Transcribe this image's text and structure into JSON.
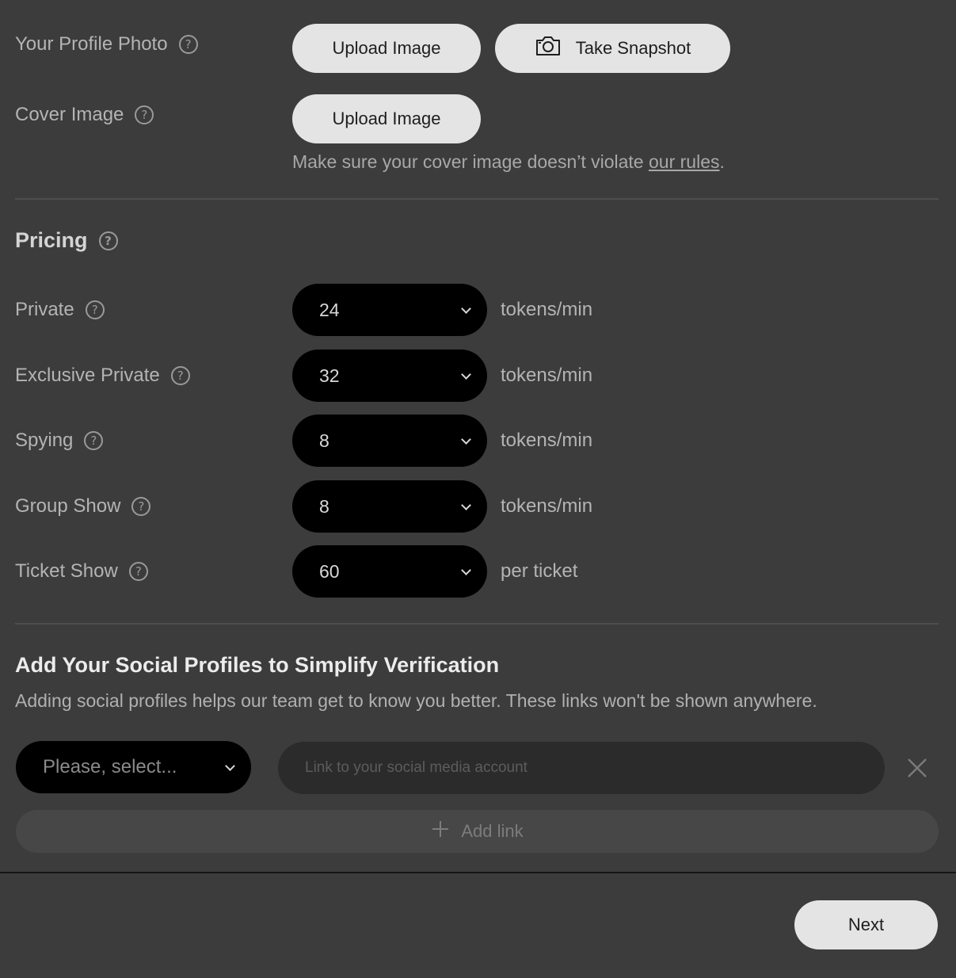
{
  "profile_photo": {
    "label": "Your Profile Photo",
    "upload_label": "Upload Image",
    "snapshot_label": "Take Snapshot"
  },
  "cover_image": {
    "label": "Cover Image",
    "upload_label": "Upload Image",
    "hint_prefix": "Make sure your cover image doesn’t violate ",
    "hint_link": "our rules",
    "hint_suffix": "."
  },
  "pricing": {
    "title": "Pricing",
    "rows": [
      {
        "label": "Private",
        "value": "24",
        "unit": "tokens/min"
      },
      {
        "label": "Exclusive Private",
        "value": "32",
        "unit": "tokens/min"
      },
      {
        "label": "Spying",
        "value": "8",
        "unit": "tokens/min"
      },
      {
        "label": "Group Show",
        "value": "8",
        "unit": "tokens/min"
      },
      {
        "label": "Ticket Show",
        "value": "60",
        "unit": "per ticket"
      }
    ]
  },
  "social": {
    "title": "Add Your Social Profiles to Simplify Verification",
    "description": "Adding social profiles helps our team get to know you better. These links won't be shown anywhere.",
    "select_placeholder": "Please, select...",
    "link_placeholder": "Link to your social media account",
    "link_value": "",
    "add_link_label": "Add link"
  },
  "footer": {
    "next_label": "Next"
  },
  "icons": {
    "help": "question-circle-icon",
    "camera": "camera-icon",
    "chevron": "chevron-down-icon",
    "close": "close-icon",
    "plus": "plus-icon"
  }
}
